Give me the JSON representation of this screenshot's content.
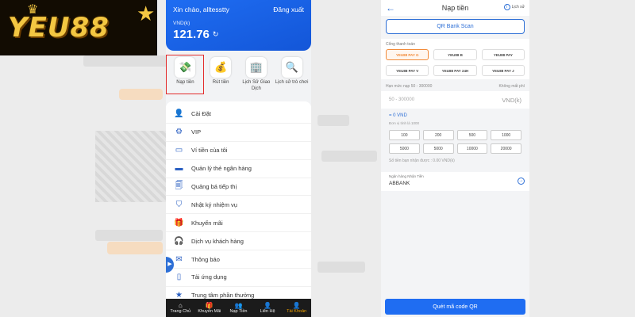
{
  "logo": {
    "text": "YEU88",
    "crown": "♛",
    "star": "★"
  },
  "account": {
    "greeting": "Xin chào, alltesstty",
    "logout": "Đăng xuất",
    "currency": "VND(k)",
    "balance": "121.76",
    "refresh_icon": "↻"
  },
  "quick_actions": [
    {
      "label": "Nạp tiền",
      "icon": "💸",
      "selected": true
    },
    {
      "label": "Rút tiền",
      "icon": "💰"
    },
    {
      "label": "Lịch Sử Giao Dịch",
      "icon": "🏢"
    },
    {
      "label": "Lịch sử trò chơi",
      "icon": "🔍"
    }
  ],
  "menu": [
    {
      "label": "Cài Đặt",
      "icon": "👤"
    },
    {
      "label": "VIP",
      "icon": "⚙"
    },
    {
      "label": "Ví tiền của tôi",
      "icon": "▭"
    },
    {
      "label": "Quản lý thẻ ngân hàng",
      "icon": "▬"
    },
    {
      "label": "Quảng bá tiếp thị",
      "icon": "🗐"
    },
    {
      "label": "Nhật ký nhiệm vụ",
      "icon": "⛉"
    },
    {
      "label": "Khuyến mãi",
      "icon": "🎁"
    },
    {
      "label": "Dịch vụ khách hàng",
      "icon": "🎧"
    },
    {
      "label": "Thông báo",
      "icon": "✉"
    },
    {
      "label": "Tải ứng dụng",
      "icon": "▯"
    },
    {
      "label": "Trung tâm phần thưởng",
      "icon": "★"
    }
  ],
  "tabs": [
    {
      "label": "Trang Chủ",
      "icon": "⌂"
    },
    {
      "label": "Khuyến Mãi",
      "icon": "🎁"
    },
    {
      "label": "Nạp Tiền",
      "icon": "👥"
    },
    {
      "label": "Liên Hệ",
      "icon": "👤"
    },
    {
      "label": "Tài Khoản",
      "icon": "👤",
      "active": true
    }
  ],
  "side_toggle": "▶",
  "deposit": {
    "back_icon": "←",
    "title": "Nạp tiền",
    "history_icon": "i",
    "history_label": "Lịch sử",
    "qr_scan": "QR Bank Scan",
    "gateway_label": "Cổng thanh toán",
    "gateways": [
      {
        "label": "YEU88 PAY G",
        "selected": true
      },
      {
        "label": "YEU88 B"
      },
      {
        "label": "YEU88 PAY"
      },
      {
        "label": "YEU88 PAY V"
      },
      {
        "label": "YEU88 PAY 24H"
      },
      {
        "label": "YEU88 PAY J"
      }
    ],
    "limit_label": "Hạn mức nạp 50 - 300000",
    "fee_label": "Không mất phí",
    "amount_placeholder": "50 - 300000",
    "amount_unit": "VND(k)",
    "converted": "= 0 VND",
    "unit_note": "Đơn vị tính là 1000",
    "amounts": [
      "100",
      "200",
      "500",
      "1000",
      "5000",
      "5000",
      "10000",
      "20000"
    ],
    "receive_note": "Số tiền bạn nhận được : 0.00 VND(k)",
    "bank_label": "Ngân hàng Nhận Tiền",
    "bank_value": "ABBANK",
    "bank_arrow": "→",
    "submit": "Quét mã code QR"
  }
}
